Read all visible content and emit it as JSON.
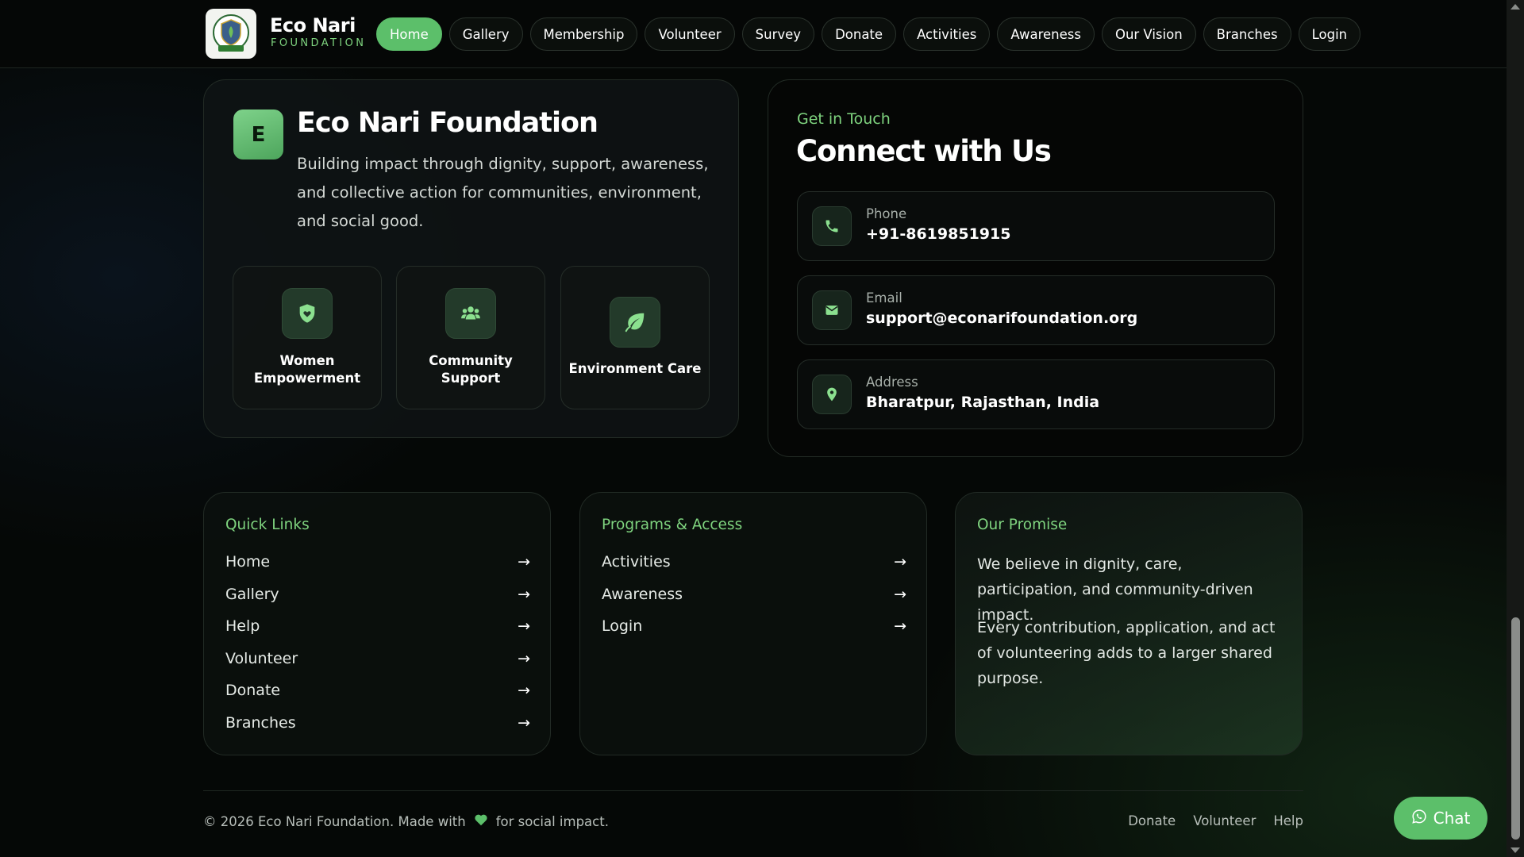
{
  "header": {
    "brand_name": "Eco Nari",
    "brand_sub": "FOUNDATION",
    "nav": [
      "Home",
      "Gallery",
      "Membership",
      "Volunteer",
      "Survey",
      "Donate",
      "Activities",
      "Awareness",
      "Our Vision",
      "Branches",
      "Login"
    ],
    "active_nav": "Home"
  },
  "about": {
    "badge": "E",
    "title": "Eco Nari Foundation",
    "description": "Building impact through dignity, support, awareness, and collective action for communities, environment, and social good.",
    "features": [
      {
        "label": "Women Empowerment",
        "icon": "shield-heart-icon"
      },
      {
        "label": "Community Support",
        "icon": "people-icon"
      },
      {
        "label": "Environment Care",
        "icon": "leaf-icon"
      }
    ]
  },
  "contact": {
    "eyebrow": "Get in Touch",
    "title": "Connect with Us",
    "rows": [
      {
        "label": "Phone",
        "value": "+91-8619851915",
        "icon": "phone-icon"
      },
      {
        "label": "Email",
        "value": "support@econarifoundation.org",
        "icon": "envelope-icon"
      },
      {
        "label": "Address",
        "value": "Bharatpur, Rajasthan, India",
        "icon": "location-pin-icon"
      }
    ]
  },
  "quick_links": {
    "title": "Quick Links",
    "items": [
      "Home",
      "Gallery",
      "Help",
      "Volunteer",
      "Donate",
      "Branches"
    ]
  },
  "programs": {
    "title": "Programs & Access",
    "items": [
      "Activities",
      "Awareness",
      "Login"
    ]
  },
  "promise": {
    "title": "Our Promise",
    "paragraphs": [
      "We believe in dignity, care, participation, and community-driven impact.",
      "Every contribution, application, and act of volunteering adds to a larger shared purpose."
    ]
  },
  "footer": {
    "copyright_before": "© 2026 Eco Nari Foundation. Made with",
    "copyright_after": "for social impact.",
    "links": [
      "Donate",
      "Volunteer",
      "Help"
    ]
  },
  "chat": {
    "label": "Chat"
  },
  "colors": {
    "accent": "#5cbf6a",
    "accent_text": "#7fd47f",
    "background": "#050806"
  }
}
